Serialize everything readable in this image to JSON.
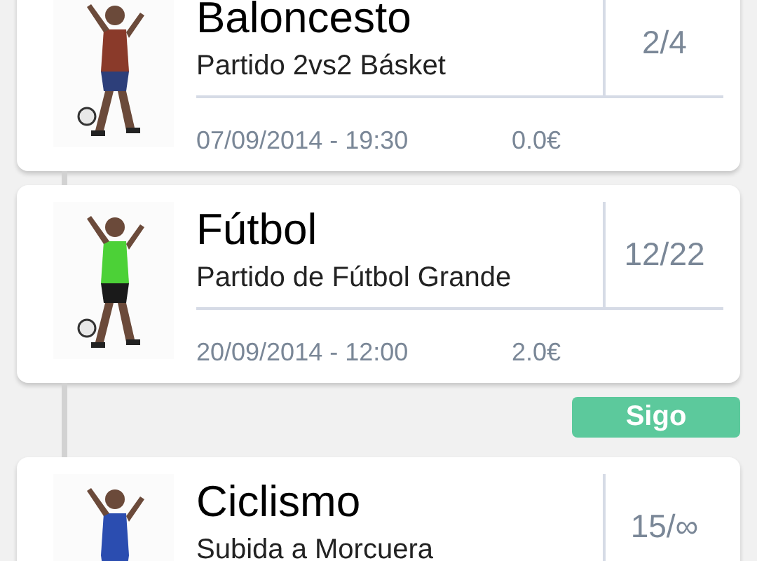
{
  "events": [
    {
      "title": "Baloncesto",
      "subtitle": "Partido 2vs2 Básket",
      "count": "2/4",
      "date": "07/09/2014 - 19:30",
      "price": "0.0€"
    },
    {
      "title": "Fútbol",
      "subtitle": "Partido de Fútbol Grande",
      "count": "12/22",
      "date": "20/09/2014 - 12:00",
      "price": "2.0€",
      "action": "Sigo"
    },
    {
      "title": "Ciclismo",
      "subtitle": "Subida a Morcuera",
      "count": "15/∞"
    }
  ]
}
